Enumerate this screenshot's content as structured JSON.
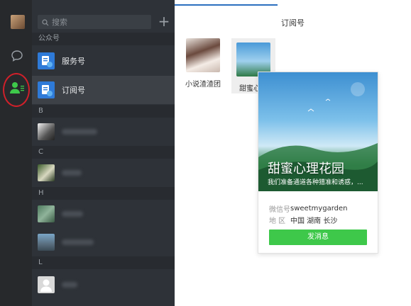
{
  "search": {
    "placeholder": "搜索",
    "add_label": "+"
  },
  "sections": {
    "official_accounts": "公众号",
    "b": "B",
    "c": "C",
    "h": "H",
    "l": "L"
  },
  "official_rows": [
    {
      "label": "服务号"
    },
    {
      "label": "订阅号"
    }
  ],
  "right_panel": {
    "title": "订阅号",
    "subscriptions": [
      {
        "label": "小说渣渣团"
      },
      {
        "label": "甜蜜心理"
      }
    ]
  },
  "card": {
    "name": "甜蜜心理花园",
    "description": "我们准备通道各种猎准和诱惑，...",
    "wechat_key": "微信号",
    "wechat_val": "sweetmygarden",
    "region_key": "地  区",
    "region_val": "中国 湖南 长沙",
    "send_label": "发消息"
  },
  "colors": {
    "accent_green": "#3ec84a",
    "highlight_red": "#d0202a",
    "sidebar_dark": "#2e3238"
  }
}
